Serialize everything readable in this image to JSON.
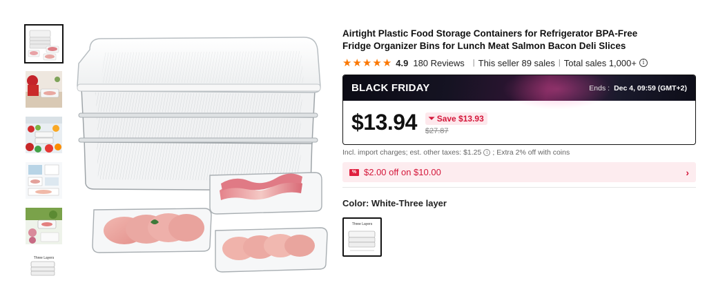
{
  "product": {
    "title": "Airtight Plastic Food Storage Containers for Refrigerator BPA-Free Fridge Organizer Bins for Lunch Meat Salmon Bacon Deli Slices",
    "rating": "4.9",
    "reviews": "180 Reviews",
    "separator": "|",
    "seller_sales": "This seller 89 sales",
    "total_sales": "Total sales 1,000+",
    "star_count": 5
  },
  "deal": {
    "label": "BLACK FRIDAY",
    "ends_label": "Ends :",
    "ends_time": "Dec 4, 09:59 (GMT+2)",
    "price": "$13.94",
    "save_label": "Save $13.93",
    "old_price": "$27.87"
  },
  "tax": {
    "prefix": "Incl. import charges; est. other taxes: $1.25",
    "suffix": "; Extra 2% off with coins"
  },
  "coupon": {
    "icon_text": "%",
    "text": "$2.00 off on $10.00"
  },
  "color": {
    "label": "Color: White-Three layer",
    "swatch_caption": "Three Layers"
  },
  "thumbnails": {
    "last_caption": "Three Layers"
  },
  "colors": {
    "accent_red": "#d4173a",
    "star_orange": "#fb7701",
    "coupon_bg": "#fdecef"
  }
}
